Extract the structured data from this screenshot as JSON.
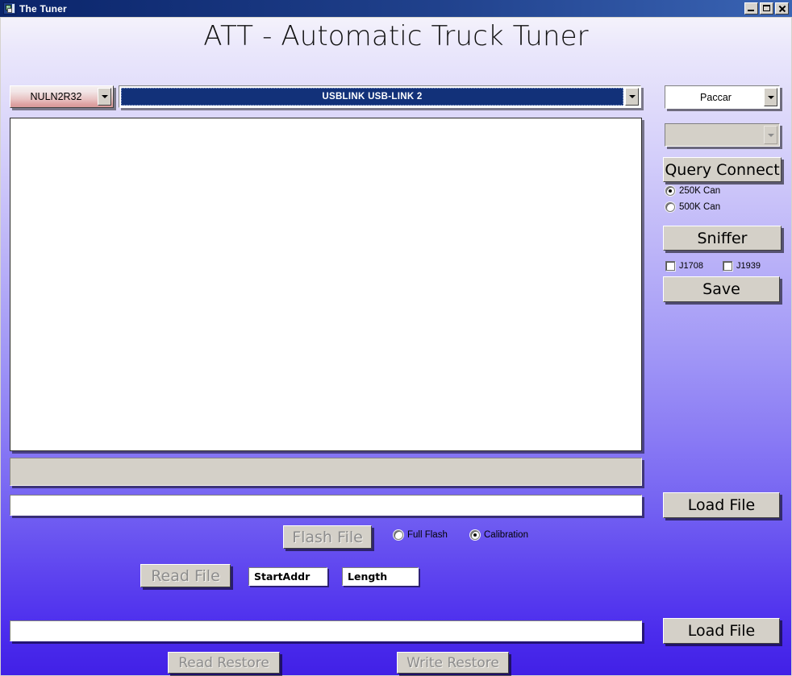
{
  "window": {
    "title": "The Tuner",
    "icon": "app-icon",
    "controls": {
      "minimize": "minimize-icon",
      "maximize": "maximize-icon",
      "close": "close-icon"
    }
  },
  "header": {
    "title": "ATT - Automatic Truck Tuner"
  },
  "toolbar": {
    "model_combo": {
      "value": "NULN2R32",
      "arrow_icon": "chevron-down-icon"
    },
    "device_combo": {
      "value": "USBLINK USB-LINK 2",
      "arrow_icon": "chevron-down-icon"
    },
    "make_combo": {
      "value": "Paccar",
      "arrow_icon": "chevron-down-icon"
    },
    "secondary_combo": {
      "value": "",
      "arrow_icon": "chevron-down-icon"
    }
  },
  "output": {
    "log_text": ""
  },
  "progress": {
    "value_text": ""
  },
  "flash_section": {
    "path_value": "",
    "path_placeholder": "",
    "flash_file_label": "Flash File",
    "load_file_label": "Load File",
    "mode_options": [
      {
        "label": "Full Flash",
        "selected": false
      },
      {
        "label": "Calibration",
        "selected": true
      }
    ],
    "read_file_label": "Read File",
    "start_addr": {
      "value": "StartAddr",
      "placeholder": "StartAddr"
    },
    "length": {
      "value": "Length",
      "placeholder": "Length"
    }
  },
  "restore_section": {
    "path_value": "",
    "path_placeholder": "",
    "load_file_label": "Load File",
    "read_restore_label": "Read Restore",
    "write_restore_label": "Write Restore"
  },
  "side_panel": {
    "query_connect_label": "Query Connect",
    "sniffer_label": "Sniffer",
    "save_label": "Save",
    "can_speed_options": [
      {
        "label": "250K Can",
        "selected": true
      },
      {
        "label": "500K Can",
        "selected": false
      }
    ],
    "protocol_checkboxes": [
      {
        "label": "J1708",
        "checked": false
      },
      {
        "label": "J1939",
        "checked": false
      }
    ]
  },
  "colors": {
    "titlebar_start": "#0a246a",
    "titlebar_end": "#3a64b4",
    "background_top": "#f4f2fb",
    "background_bottom": "#4120e6",
    "control_face": "#d4d0c8",
    "selection_blue": "#123179",
    "model_combo_accent": "#dca0a0",
    "disabled_text": "#8d8d8d"
  }
}
